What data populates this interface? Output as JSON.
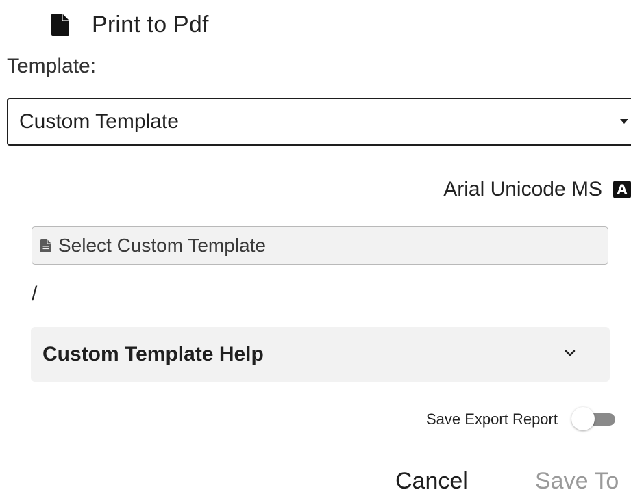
{
  "header": {
    "title": "Print to Pdf",
    "icon": "document-icon"
  },
  "template": {
    "label": "Template:",
    "selected": "Custom Template",
    "dropdown_icon": "caret-down-icon"
  },
  "font": {
    "name": "Arial Unicode MS",
    "icon": "font-icon",
    "icon_glyph": "A"
  },
  "custom_template": {
    "select_label": "Select Custom Template",
    "icon": "file-icon",
    "path": "/"
  },
  "help": {
    "title": "Custom Template Help",
    "icon": "chevron-down-icon"
  },
  "options": {
    "save_report_label": "Save Export Report",
    "save_report_enabled": false
  },
  "actions": {
    "cancel_label": "Cancel",
    "save_label": "Save To"
  },
  "colors": {
    "text": "#1f1f1f",
    "disabled_text": "#9a9a9a",
    "panel_bg": "#f2f2f2",
    "toggle_track": "#8a8a8a"
  }
}
